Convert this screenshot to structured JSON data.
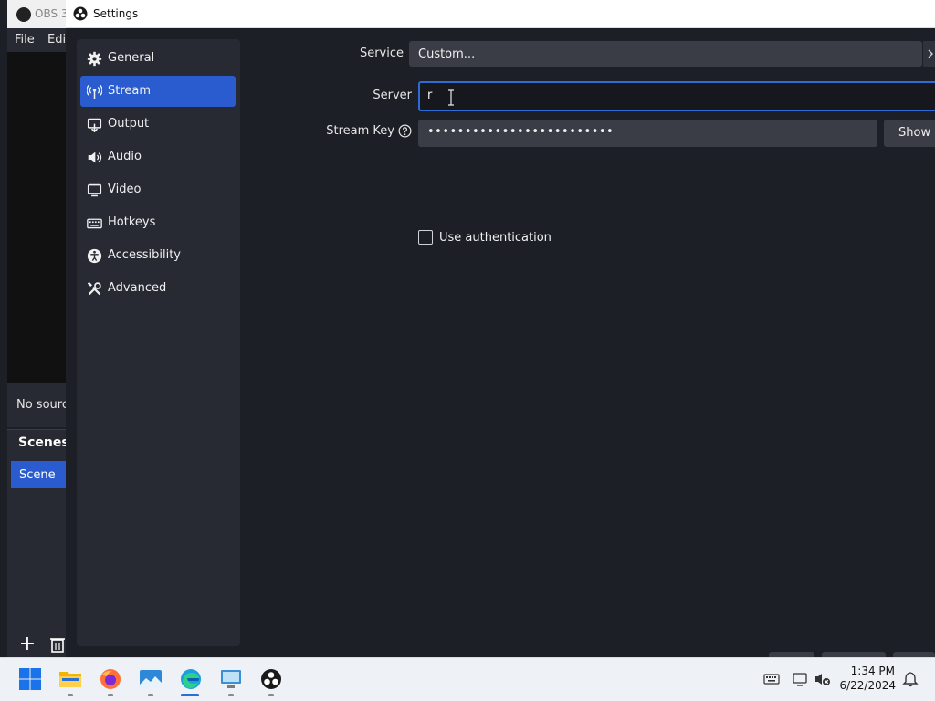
{
  "obs_main": {
    "title": "OBS 3",
    "menu": [
      "File",
      "Edi"
    ],
    "sources_empty": "No sourc",
    "scenes_label": "Scenes",
    "scene_item": "Scene"
  },
  "settings": {
    "title": "Settings",
    "nav": [
      {
        "label": "General",
        "icon": "gear-icon"
      },
      {
        "label": "Stream",
        "icon": "antenna-icon",
        "active": true
      },
      {
        "label": "Output",
        "icon": "output-icon"
      },
      {
        "label": "Audio",
        "icon": "speaker-icon"
      },
      {
        "label": "Video",
        "icon": "monitor-icon"
      },
      {
        "label": "Hotkeys",
        "icon": "keyboard-icon"
      },
      {
        "label": "Accessibility",
        "icon": "accessibility-icon"
      },
      {
        "label": "Advanced",
        "icon": "tools-icon"
      }
    ],
    "form": {
      "service_label": "Service",
      "service_value": "Custom...",
      "server_label": "Server",
      "server_value": "r",
      "streamkey_label": "Stream Key",
      "streamkey_value": "•••••••••••••••••••••••••",
      "show_label": "Show",
      "auth_label": "Use authentication",
      "auth_checked": false
    }
  },
  "taskbar": {
    "apps": [
      "start-icon",
      "file-explorer-icon",
      "firefox-icon",
      "photos-icon",
      "edge-icon",
      "remote-desktop-icon",
      "obs-icon"
    ],
    "clock_time": "1:34 PM",
    "clock_date": "6/22/2024"
  },
  "colors": {
    "accent": "#2a5ccf",
    "background": "#1d1f26",
    "panel": "#272a33",
    "input": "#3a3d46"
  }
}
